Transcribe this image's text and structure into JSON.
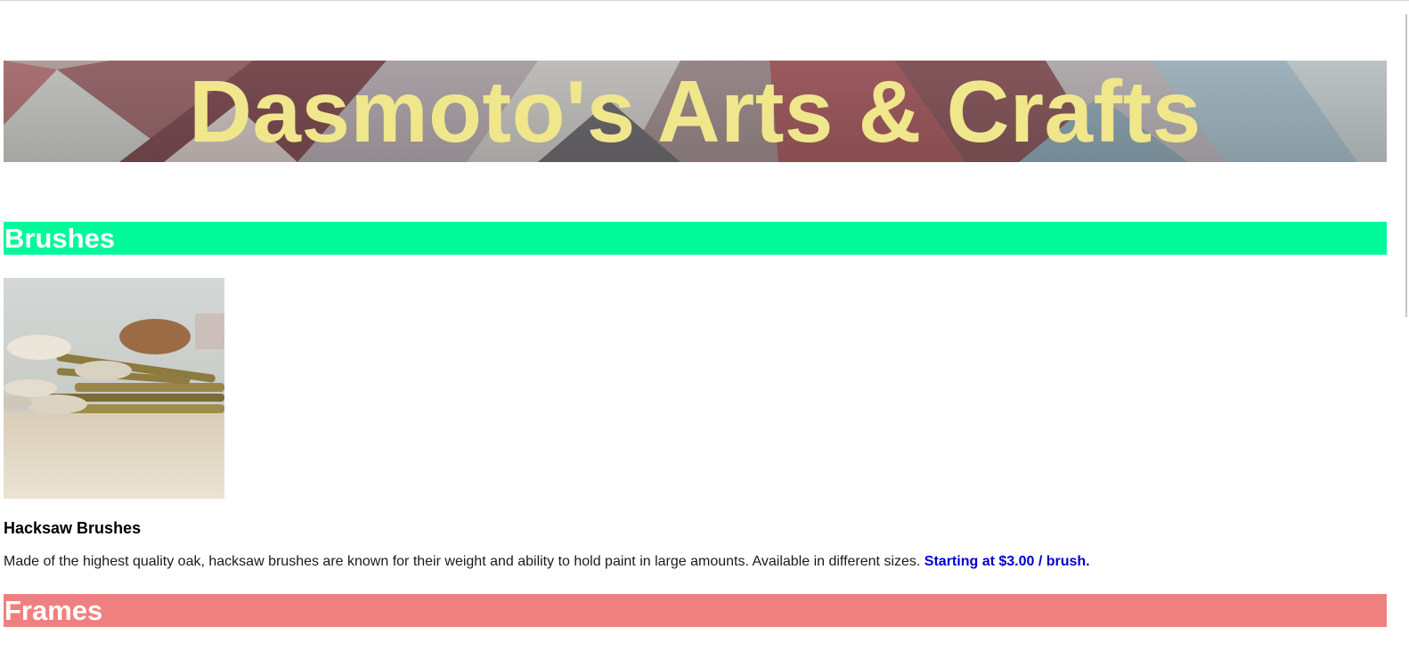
{
  "banner": {
    "title": "Dasmoto's Arts & Crafts",
    "title_color": "#F0E68C"
  },
  "sections": {
    "brushes": {
      "heading": "Brushes",
      "color": "#00FA9A"
    },
    "frames": {
      "heading": "Frames",
      "color": "#F08080"
    }
  },
  "product": {
    "image_name": "hacksaw-brushes-photo",
    "name": "Hacksaw Brushes",
    "description": "Made of the highest quality oak, hacksaw brushes are known for their weight and ability to hold paint in large amounts. Available in different sizes.",
    "price": "Starting at $3.00 / brush.",
    "price_color": "#0000CD"
  }
}
